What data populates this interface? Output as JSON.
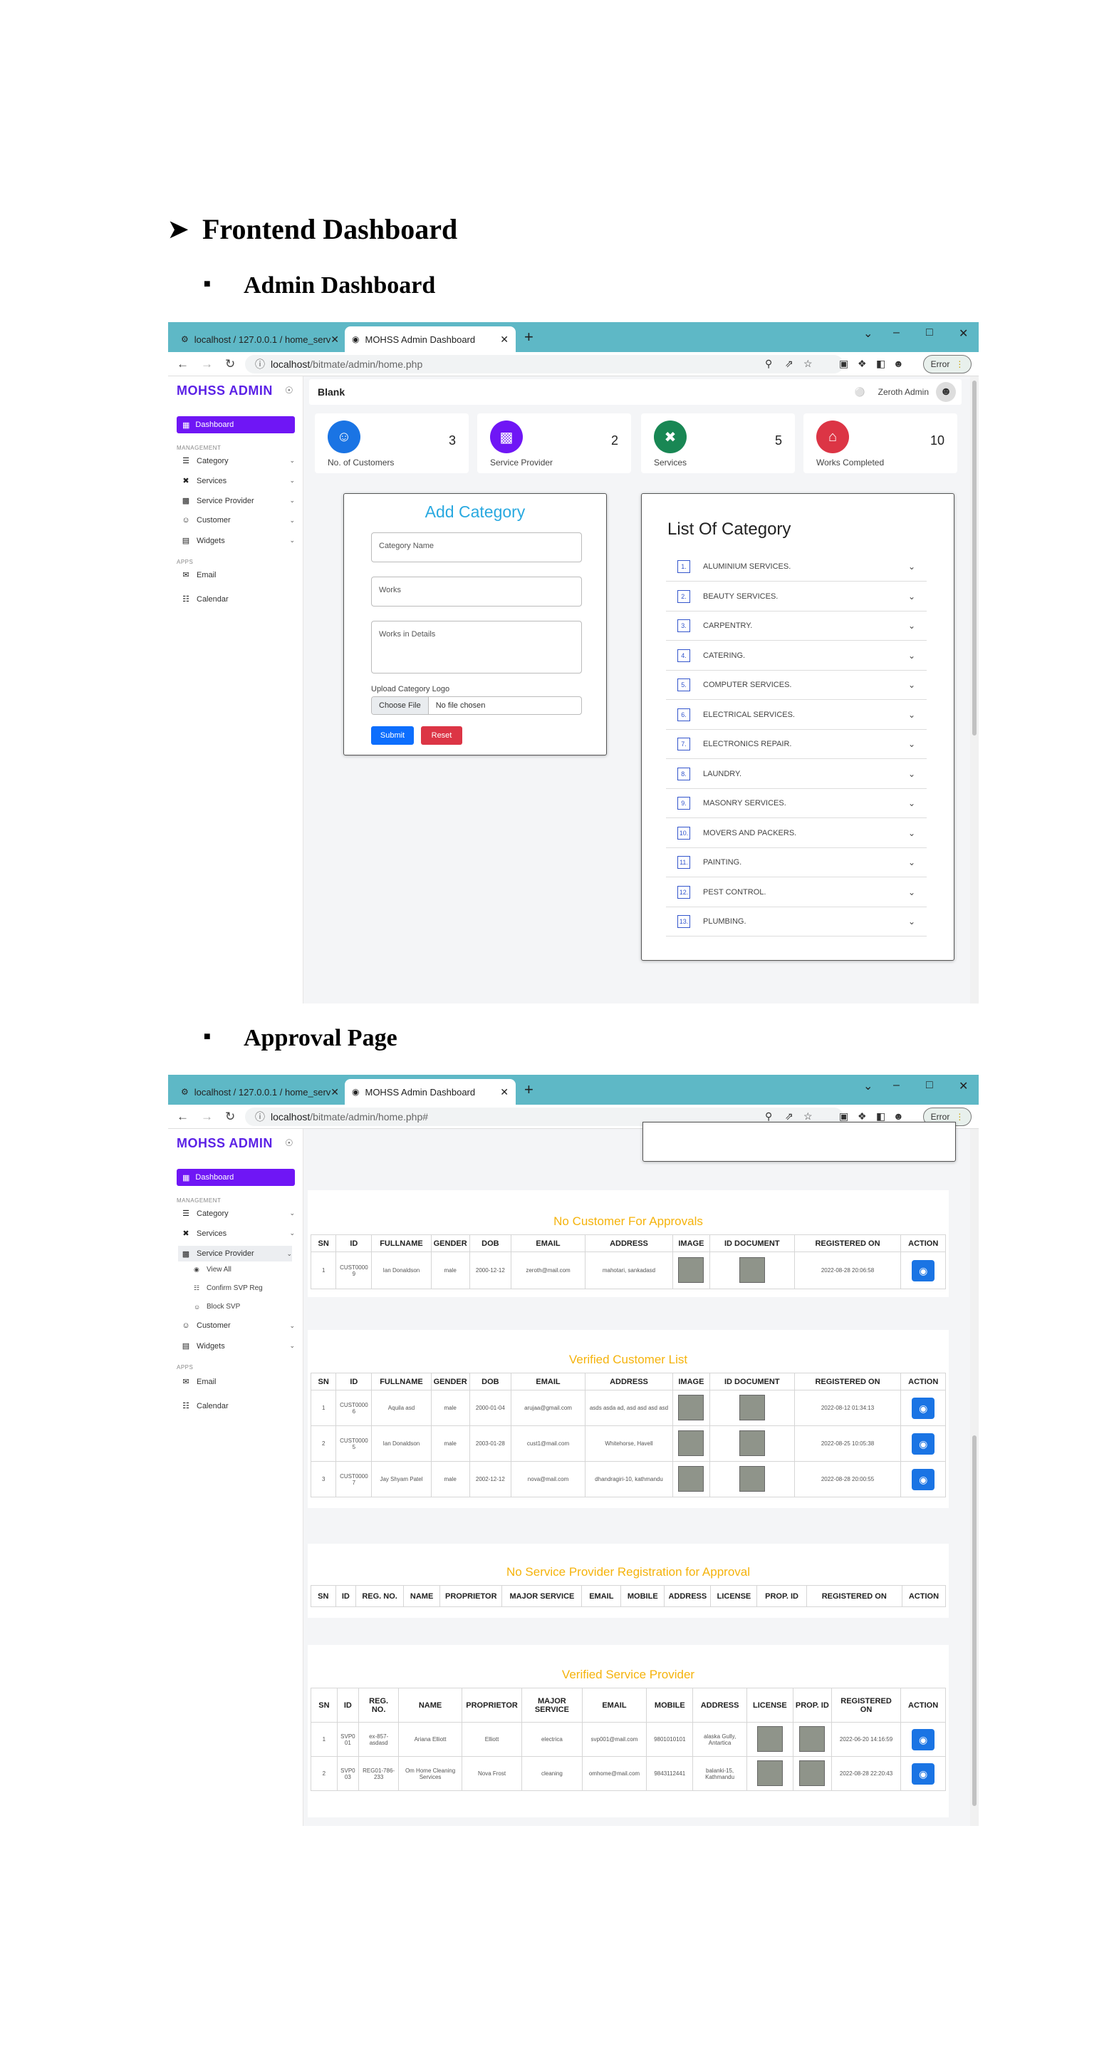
{
  "doc": {
    "heading": "Frontend Dashboard",
    "sub1": "Admin Dashboard",
    "sub2": "Approval Page"
  },
  "browser": {
    "tab_inactive": "localhost / 127.0.0.1 / home_serv",
    "tab_active": "MOHSS Admin Dashboard",
    "error_label": "Error",
    "url1_host": "localhost",
    "url1_path": "/bitmate/admin/home.php",
    "url2_path": "/bitmate/admin/home.php#"
  },
  "sidebar": {
    "brand": "MOHSS ADMIN",
    "dashboard": "Dashboard",
    "management": "MANAGEMENT",
    "apps": "APPS",
    "items": [
      "Category",
      "Services",
      "Service Provider",
      "Customer",
      "Widgets"
    ],
    "apps_items": [
      "Email",
      "Calendar"
    ],
    "sp_sub": [
      "View All",
      "Confirm SVP Reg",
      "Block SVP"
    ]
  },
  "topbar": {
    "title": "Blank",
    "user": "Zeroth Admin"
  },
  "stats": [
    {
      "label": "No. of Customers",
      "value": "3",
      "color": "#1a74e4"
    },
    {
      "label": "Service Provider",
      "value": "2",
      "color": "#6f16f5"
    },
    {
      "label": "Services",
      "value": "5",
      "color": "#198754"
    },
    {
      "label": "Works Completed",
      "value": "10",
      "color": "#dc3545"
    }
  ],
  "add_category": {
    "title": "Add Category",
    "name_ph": "Category Name",
    "works_ph": "Works",
    "details_ph": "Works in Details",
    "upload_label": "Upload Category Logo",
    "choose": "Choose File",
    "no_file": "No file chosen",
    "submit": "Submit",
    "reset": "Reset"
  },
  "category_list": {
    "title": "List Of Category",
    "items": [
      {
        "n": "1.",
        "name": "ALUMINIUM SERVICES."
      },
      {
        "n": "2.",
        "name": "BEAUTY SERVICES."
      },
      {
        "n": "3.",
        "name": "CARPENTRY."
      },
      {
        "n": "4.",
        "name": "CATERING."
      },
      {
        "n": "5.",
        "name": "COMPUTER SERVICES."
      },
      {
        "n": "6.",
        "name": "ELECTRICAL SERVICES."
      },
      {
        "n": "7.",
        "name": "ELECTRONICS REPAIR."
      },
      {
        "n": "8.",
        "name": "LAUNDRY."
      },
      {
        "n": "9.",
        "name": "MASONRY SERVICES."
      },
      {
        "n": "10.",
        "name": "MOVERS AND PACKERS."
      },
      {
        "n": "11.",
        "name": "PAINTING."
      },
      {
        "n": "12.",
        "name": "PEST CONTROL."
      },
      {
        "n": "13.",
        "name": "PLUMBING."
      }
    ]
  },
  "pending_customers": {
    "title": "No Customer For Approvals",
    "headers": [
      "SN",
      "ID",
      "FULLNAME",
      "GENDER",
      "DOB",
      "EMAIL",
      "ADDRESS",
      "IMAGE",
      "ID DOCUMENT",
      "REGISTERED ON",
      "ACTION"
    ],
    "rows": [
      [
        "1",
        "CUST00009",
        "Ian Donaldson",
        "male",
        "2000-12-12",
        "zeroth@mail.com",
        "mahotari, sankadasd",
        "",
        "",
        "2022-08-28 20:06:58",
        ""
      ]
    ]
  },
  "verified_customers": {
    "title": "Verified Customer List",
    "headers": [
      "SN",
      "ID",
      "FULLNAME",
      "GENDER",
      "DOB",
      "EMAIL",
      "ADDRESS",
      "IMAGE",
      "ID DOCUMENT",
      "REGISTERED ON",
      "ACTION"
    ],
    "rows": [
      [
        "1",
        "CUST00006",
        "Aquila asd",
        "male",
        "2000-01-04",
        "arujaa@gmail.com",
        "asds asda ad, asd asd asd asd",
        "",
        "",
        "2022-08-12 01:34:13",
        ""
      ],
      [
        "2",
        "CUST00005",
        "Ian Donaldson",
        "male",
        "2003-01-28",
        "cust1@mail.com",
        "Whitehorse, Havell",
        "",
        "",
        "2022-08-25 10:05:38",
        ""
      ],
      [
        "3",
        "CUST00007",
        "Jay Shyam Patel",
        "male",
        "2002-12-12",
        "nova@mail.com",
        "dhandragiri-10, kathmandu",
        "",
        "",
        "2022-08-28 20:00:55",
        ""
      ]
    ]
  },
  "pending_sp": {
    "title": "No Service Provider Registration for Approval",
    "headers": [
      "SN",
      "ID",
      "REG. NO.",
      "NAME",
      "PROPRIETOR",
      "MAJOR SERVICE",
      "EMAIL",
      "MOBILE",
      "ADDRESS",
      "LICENSE",
      "PROP. ID",
      "REGISTERED ON",
      "ACTION"
    ]
  },
  "verified_sp": {
    "title": "Verified Service Provider",
    "headers": [
      "SN",
      "ID",
      "REG. NO.",
      "NAME",
      "PROPRIETOR",
      "MAJOR SERVICE",
      "EMAIL",
      "MOBILE",
      "ADDRESS",
      "LICENSE",
      "PROP. ID",
      "REGISTERED ON",
      "ACTION"
    ],
    "rows": [
      [
        "1",
        "SVP001",
        "ex-857-asdasd",
        "Ariana Elliott",
        "Elliott",
        "electrica",
        "svp001@mail.com",
        "9801010101",
        "alaska Gully, Antartica",
        "",
        "",
        "2022-06-20 14:16:59",
        ""
      ],
      [
        "2",
        "SVP003",
        "REG01-786-233",
        "Om Home Cleaning Services",
        "Nova Frost",
        "cleaning",
        "omhome@mail.com",
        "9843112441",
        "balanki-15, Kathmandu",
        "",
        "",
        "2022-08-28 22:20:43",
        ""
      ]
    ]
  }
}
